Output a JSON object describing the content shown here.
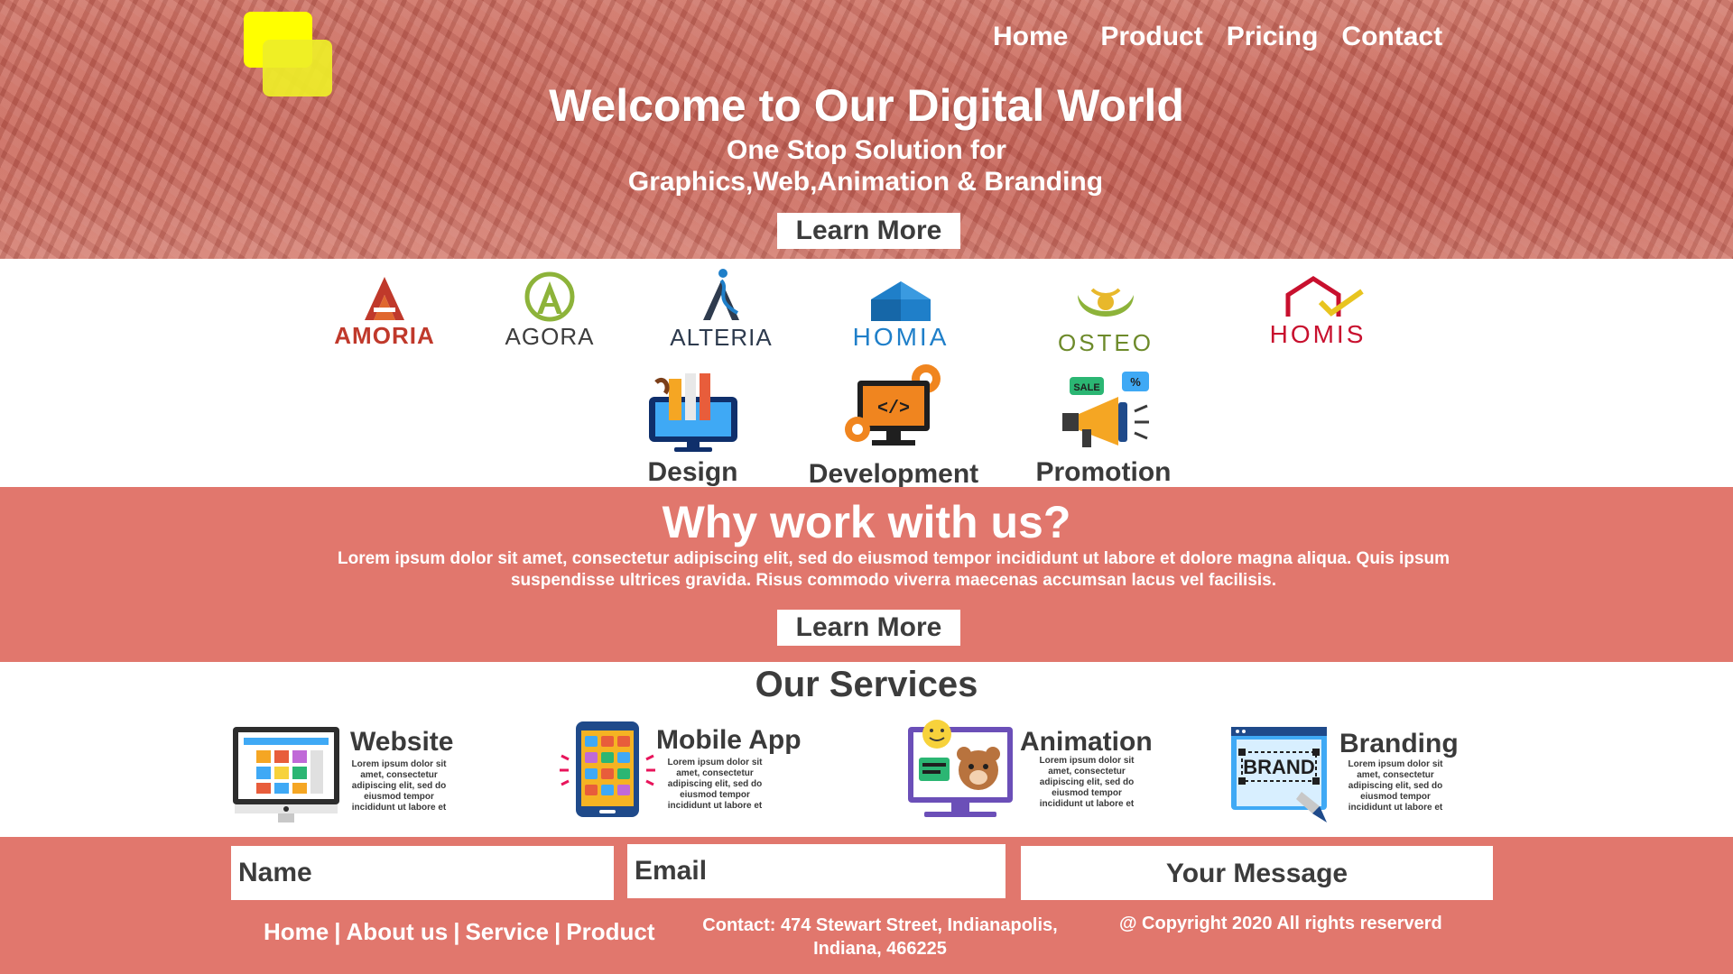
{
  "nav": {
    "items": [
      "Home",
      "Product",
      "Pricing",
      "Contact"
    ]
  },
  "hero": {
    "title": "Welcome to Our Digital World",
    "subtitle_line1": "One Stop Solution for",
    "subtitle_line2": "Graphics,Web,Animation & Branding",
    "button_label": "Learn More"
  },
  "clients": [
    {
      "name": "AMORIA",
      "color": "#c0392b"
    },
    {
      "name": "AGORA",
      "color": "#3d3d3d"
    },
    {
      "name": "ALTERIA",
      "color": "#2e3b4e"
    },
    {
      "name": "HOMIA",
      "color": "#1f7fc9"
    },
    {
      "name": "OSTEO",
      "color": "#6d8a2a"
    },
    {
      "name": "HOMIS",
      "color": "#c8102e"
    }
  ],
  "features": [
    {
      "label": "Design",
      "icon": "design-monitor-icon"
    },
    {
      "label": "Development",
      "icon": "development-code-icon"
    },
    {
      "label": "Promotion",
      "icon": "megaphone-icon"
    }
  ],
  "why": {
    "title": "Why work with us?",
    "text": "Lorem ipsum dolor sit amet, consectetur adipiscing elit, sed do eiusmod tempor incididunt ut labore et dolore magna aliqua. Quis ipsum suspendisse ultrices gravida. Risus commodo viverra maecenas accumsan lacus vel facilisis.",
    "button_label": "Learn More"
  },
  "services": {
    "title": "Our Services",
    "items": [
      {
        "name": "Website",
        "desc": "Lorem ipsum dolor sit amet, consectetur adipiscing elit, sed do eiusmod tempor incididunt ut labore et",
        "icon": "website-monitor-icon"
      },
      {
        "name": "Mobile App",
        "desc": "Lorem ipsum dolor sit amet, consectetur adipiscing elit, sed do eiusmod tempor incididunt ut labore et",
        "icon": "mobile-phone-icon"
      },
      {
        "name": "Animation",
        "desc": "Lorem ipsum dolor sit amet, consectetur adipiscing elit, sed do eiusmod tempor incididunt ut labore et",
        "icon": "animation-screen-icon"
      },
      {
        "name": "Branding",
        "desc": "Lorem ipsum dolor sit amet, consectetur adipiscing elit, sed do eiusmod tempor incididunt ut labore et",
        "icon": "brand-pen-icon"
      }
    ]
  },
  "form": {
    "name_placeholder": "Name",
    "email_placeholder": "Email",
    "message_placeholder": "Your Message"
  },
  "footer": {
    "links": [
      "Home",
      "About us",
      "Service",
      "Product"
    ],
    "contact_line1": "Contact: 474 Stewart Street, Indianapolis,",
    "contact_line2": "Indiana, 466225",
    "copyright": "@ Copyright 2020 All rights reserverd"
  },
  "colors": {
    "accent": "#e1776d",
    "logo_yellow": "#ffff00",
    "text_dark": "#3c3c3c"
  }
}
